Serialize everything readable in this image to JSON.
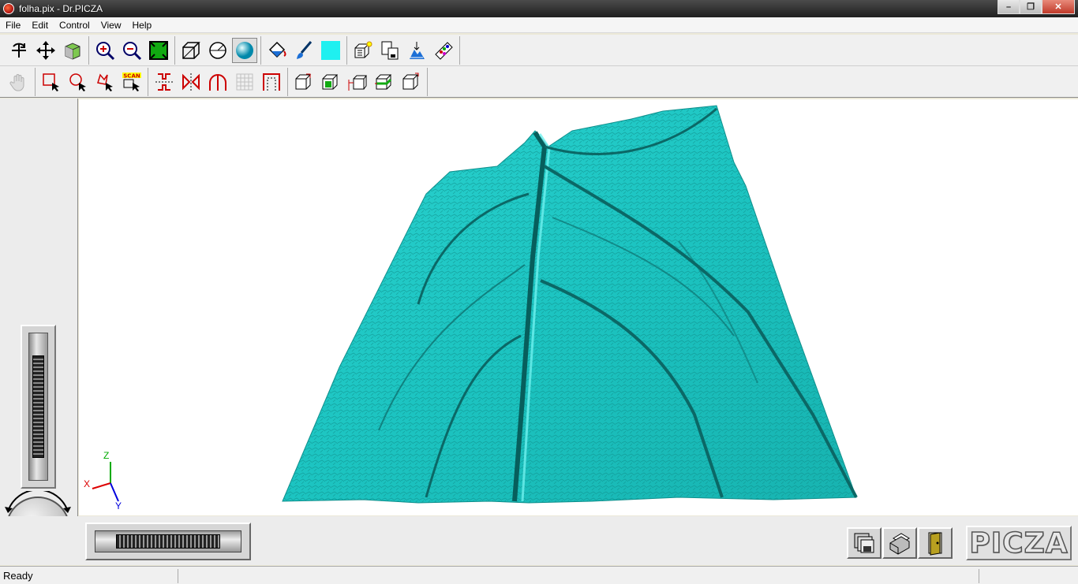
{
  "window": {
    "title": "folha.pix - Dr.PICZA"
  },
  "menu": [
    {
      "label": "File"
    },
    {
      "label": "Edit"
    },
    {
      "label": "Control"
    },
    {
      "label": "View"
    },
    {
      "label": "Help"
    }
  ],
  "toolbar1": [
    {
      "icon": "rotate-icon"
    },
    {
      "icon": "move-icon"
    },
    {
      "icon": "cube-color-icon"
    },
    {
      "icon": "zoom-in-icon"
    },
    {
      "icon": "zoom-out-icon"
    },
    {
      "icon": "fit-view-icon"
    },
    {
      "icon": "wireframe-box-icon"
    },
    {
      "icon": "wireframe-sphere-icon"
    },
    {
      "icon": "shaded-sphere-icon",
      "pressed": true
    },
    {
      "icon": "fill-bucket-icon"
    },
    {
      "icon": "brush-icon"
    },
    {
      "icon": "cyan-color-swatch-icon"
    },
    {
      "icon": "light-box-icon"
    },
    {
      "icon": "copy-export-icon"
    },
    {
      "icon": "texture-map-icon"
    },
    {
      "icon": "palette-icon"
    }
  ],
  "toolbar2": [
    {
      "icon": "hand-pan-icon",
      "disabled": true
    },
    {
      "icon": "rect-select-icon"
    },
    {
      "icon": "circle-select-icon"
    },
    {
      "icon": "lasso-select-icon"
    },
    {
      "icon": "scan-select-icon",
      "label": "SCAN"
    },
    {
      "icon": "flip-vertical-icon"
    },
    {
      "icon": "flip-horizontal-icon"
    },
    {
      "icon": "arch-icon"
    },
    {
      "icon": "grid-icon",
      "disabled": true
    },
    {
      "icon": "crop-frame-icon"
    },
    {
      "icon": "box-front-icon"
    },
    {
      "icon": "box-side-icon"
    },
    {
      "icon": "box-scale-icon"
    },
    {
      "icon": "box-slice-icon"
    },
    {
      "icon": "box-top-icon"
    }
  ],
  "axes": {
    "x": "X",
    "y": "Y",
    "z": "Z"
  },
  "colors": {
    "surface": "#1fc7c4",
    "surface_dark": "#0d7a78"
  },
  "bottom_buttons": [
    {
      "icon": "save-disk-icon"
    },
    {
      "icon": "print-icon"
    },
    {
      "icon": "exit-door-icon"
    }
  ],
  "logo": {
    "text": "PICZA"
  },
  "status": {
    "text": "Ready"
  }
}
